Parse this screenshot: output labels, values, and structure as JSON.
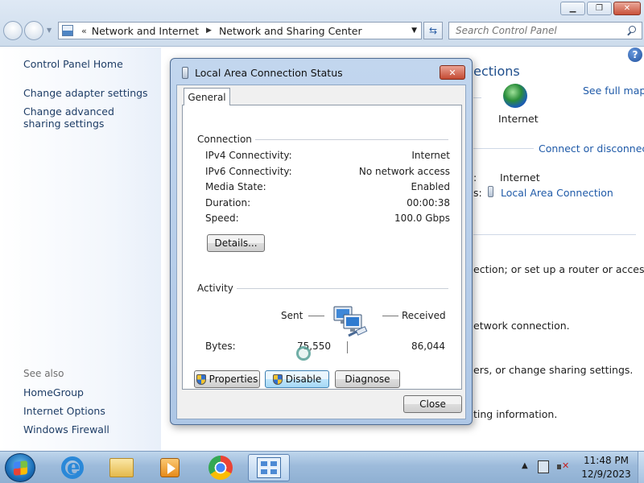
{
  "window": {
    "breadcrumb": [
      "Network and Internet",
      "Network and Sharing Center"
    ],
    "search_placeholder": "Search Control Panel"
  },
  "sidebar": {
    "links": [
      "Control Panel Home",
      "Change adapter settings",
      "Change advanced sharing settings"
    ],
    "see_also_label": "See also",
    "see_also_links": [
      "HomeGroup",
      "Internet Options",
      "Windows Firewall"
    ]
  },
  "background": {
    "title_fragment": "nections",
    "see_full_map": "See full map",
    "internet_label": "Internet",
    "connect_or_disconnect": "Connect or disconnect",
    "access_type_value": "Internet",
    "local_area_connection": "Local Area Connection",
    "text_router": "ection; or set up a router or access",
    "text_network": "etwork connection.",
    "text_sharing": "ers, or change sharing settings.",
    "text_info": "ting information."
  },
  "dialog": {
    "title": "Local Area Connection Status",
    "tab": "General",
    "connection_group": "Connection",
    "connection_rows": [
      {
        "label": "IPv4 Connectivity:",
        "value": "Internet"
      },
      {
        "label": "IPv6 Connectivity:",
        "value": "No network access"
      },
      {
        "label": "Media State:",
        "value": "Enabled"
      },
      {
        "label": "Duration:",
        "value": "00:00:38"
      },
      {
        "label": "Speed:",
        "value": "100.0 Gbps"
      }
    ],
    "details_button": "Details...",
    "activity_group": "Activity",
    "sent_label": "Sent",
    "received_label": "Received",
    "bytes_label": "Bytes:",
    "bytes_sent": "75,550",
    "bytes_received": "86,044",
    "properties_button": "Properties",
    "disable_button": "Disable",
    "diagnose_button": "Diagnose",
    "close_button": "Close"
  },
  "taskbar": {
    "time": "11:48 PM",
    "date": "12/9/2023"
  }
}
